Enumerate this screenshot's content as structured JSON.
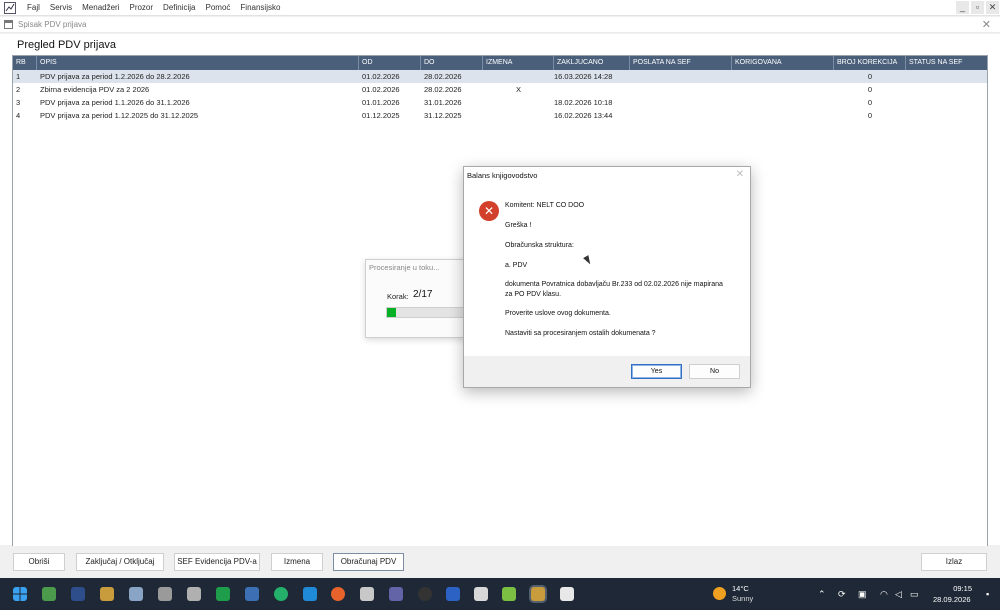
{
  "menu": [
    "Fajl",
    "Servis",
    "Menadžeri",
    "Prozor",
    "Definicija",
    "Pomoć",
    "Finansijsko"
  ],
  "window_controls": [
    "_",
    "▫",
    "✕"
  ],
  "child_window": {
    "title": "Spisak PDV prijava",
    "close": "✕"
  },
  "page_title": "Pregled PDV prijava",
  "table": {
    "columns": [
      "RB",
      "OPIS",
      "OD",
      "DO",
      "IZMENA",
      "ZAKLJUCANO",
      "POSLATA NA SEF",
      "KORIGOVANA",
      "BROJ KOREKCIJA",
      "STATUS NA SEF"
    ],
    "rows": [
      {
        "rb": "1",
        "opis": "PDV prijava za period 1.2.2026 do 28.2.2026",
        "od": "01.02.2026",
        "do": "28.02.2026",
        "izmena": "",
        "zakljucano": "16.03.2026 14:28",
        "poslata": "",
        "korigovana": "",
        "broj": "0",
        "status": ""
      },
      {
        "rb": "2",
        "opis": "Zbirna evidencija PDV za 2 2026",
        "od": "01.02.2026",
        "do": "28.02.2026",
        "izmena": "X",
        "zakljucano": "",
        "poslata": "",
        "korigovana": "",
        "broj": "0",
        "status": ""
      },
      {
        "rb": "3",
        "opis": "PDV prijava za period 1.1.2026 do 31.1.2026",
        "od": "01.01.2026",
        "do": "31.01.2026",
        "izmena": "",
        "zakljucano": "18.02.2026 10:18",
        "poslata": "",
        "korigovana": "",
        "broj": "0",
        "status": ""
      },
      {
        "rb": "4",
        "opis": "PDV prijava za period 1.12.2025 do 31.12.2025",
        "od": "01.12.2025",
        "do": "31.12.2025",
        "izmena": "",
        "zakljucano": "16.02.2026 13:44",
        "poslata": "",
        "korigovana": "",
        "broj": "0",
        "status": ""
      }
    ],
    "selected_row": 1
  },
  "buttons": {
    "obrisi": "Obriši",
    "zakljucaj": "Zaključaj / Otključaj",
    "sef": "SEF Evidencija PDV-a",
    "izmena": "Izmena",
    "obracunaj": "Obračunaj PDV",
    "izlaz": "Izlaz"
  },
  "progress": {
    "title": "Procesiranje u toku...",
    "step_label": "Korak:",
    "step_value": "2/17",
    "fraction": 0.12
  },
  "dialog": {
    "title": "Balans knjigovodstvo",
    "close": "✕",
    "icon": "error-icon",
    "lines": [
      "Komitent: NELT CO DOO",
      "Greška !",
      "Obračunska struktura:",
      "a. PDV",
      "dokumenta Povratnica dobavljaču Br.233 od 02.02.2026 nije mapirana",
      "za PO PDV klasu.",
      "Proverite uslove ovog dokumenta.",
      "Nastaviti sa procesiranjem ostalih dokumenata ?"
    ],
    "yes": "Yes",
    "no": "No"
  },
  "taskbar": {
    "temperature": "14°C",
    "condition": "Sunny",
    "time": "09:15",
    "date": "28.09.2026"
  },
  "colors": {
    "header": "#4a5f7a",
    "selected_row": "#dde3ec",
    "error": "#d23f2a",
    "taskbar": "#1f2836",
    "progress_fill": "#06b025"
  }
}
